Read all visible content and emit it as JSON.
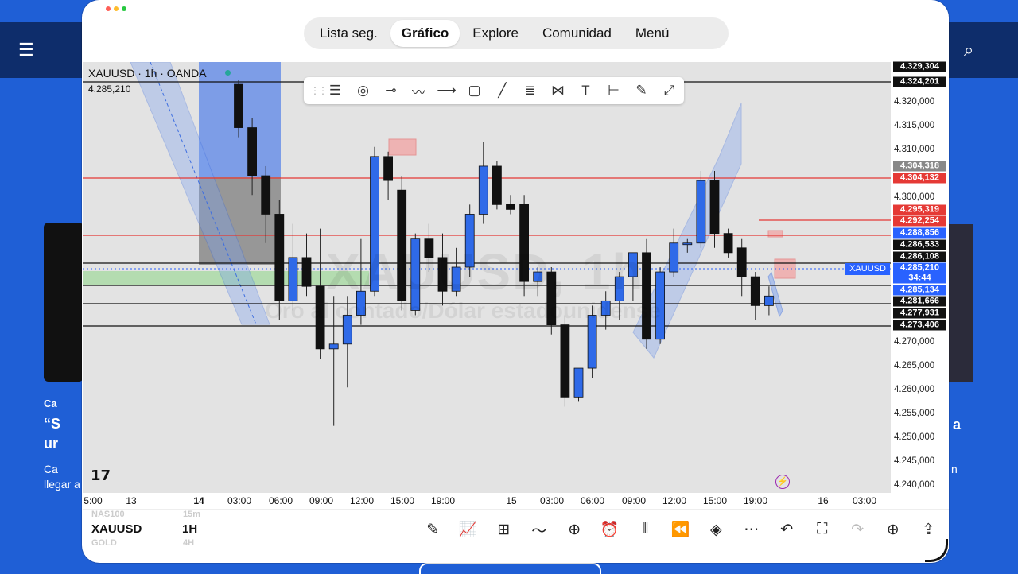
{
  "window": {
    "dot_colors": [
      "#ff5f57",
      "#febc2e",
      "#28c840"
    ]
  },
  "tabs": [
    {
      "label": "Lista seg.",
      "active": false
    },
    {
      "label": "Gráfico",
      "active": true
    },
    {
      "label": "Explore",
      "active": false
    },
    {
      "label": "Comunidad",
      "active": false
    },
    {
      "label": "Menú",
      "active": false
    }
  ],
  "chart": {
    "symbol_line": "XAUUSD · 1h · OANDA",
    "last_price": "4.285,210",
    "watermark_symbol": "XAUUSD, 1h",
    "watermark_name": "Oro al contado/Dólar estadounidense",
    "symbol_tag": "XAUUSD"
  },
  "drawing_tools": [
    "horizontal-lines-icon",
    "circle-target-icon",
    "ray-icon",
    "path-icon",
    "horizontal-ray-icon",
    "rectangle-icon",
    "trend-line-icon",
    "fib-icon",
    "pattern-icon",
    "text-icon",
    "measure-icon",
    "brush-icon",
    "projection-icon"
  ],
  "price_axis": {
    "ticks": [
      "4.320,000",
      "4.315,000",
      "4.310,000",
      "4.300,000",
      "4.270,000",
      "4.265,000",
      "4.260,000",
      "4.255,000",
      "4.250,000",
      "4.245,000",
      "4.240,000"
    ],
    "tags": [
      {
        "label": "4.329,304",
        "color": "#111111"
      },
      {
        "label": "4.324,201",
        "color": "#111111"
      },
      {
        "label": "4.304,318",
        "color": "#888888"
      },
      {
        "label": "4.304,132",
        "color": "#e53935"
      },
      {
        "label": "4.295,319",
        "color": "#e53935"
      },
      {
        "label": "4.292,254",
        "color": "#e53935"
      },
      {
        "label": "4.288,856",
        "color": "#2962ff"
      },
      {
        "label": "4.286,533",
        "color": "#111111"
      },
      {
        "label": "4.286,108",
        "color": "#111111"
      },
      {
        "label": "4.285,210",
        "color": "#2962ff"
      },
      {
        "label": "34:44",
        "color": "#2962ff"
      },
      {
        "label": "4.285,134",
        "color": "#2962ff"
      },
      {
        "label": "4.281,666",
        "color": "#111111"
      },
      {
        "label": "4.277,931",
        "color": "#111111"
      },
      {
        "label": "4.273,406",
        "color": "#111111"
      }
    ]
  },
  "time_axis": [
    {
      "label": "5:00",
      "bold": false
    },
    {
      "label": "13",
      "bold": false
    },
    {
      "label": "14",
      "bold": true
    },
    {
      "label": "03:00",
      "bold": false
    },
    {
      "label": "06:00",
      "bold": false
    },
    {
      "label": "09:00",
      "bold": false
    },
    {
      "label": "12:00",
      "bold": false
    },
    {
      "label": "15:00",
      "bold": false
    },
    {
      "label": "19:00",
      "bold": false
    },
    {
      "label": "15",
      "bold": false
    },
    {
      "label": "03:00",
      "bold": false
    },
    {
      "label": "06:00",
      "bold": false
    },
    {
      "label": "09:00",
      "bold": false
    },
    {
      "label": "12:00",
      "bold": false
    },
    {
      "label": "15:00",
      "bold": false
    },
    {
      "label": "19:00",
      "bold": false
    },
    {
      "label": "16",
      "bold": false
    },
    {
      "label": "03:00",
      "bold": false
    }
  ],
  "bottom_bar": {
    "symbol": "XAUUSD",
    "timeframe": "1H",
    "ghost_symbols": [
      "NAS100",
      "GOLD"
    ],
    "ghost_timeframes": [
      "15m",
      "4H"
    ],
    "icons": [
      "pencil-icon",
      "indicators-icon",
      "layout-grid-icon",
      "compare-icon",
      "add-icon",
      "alert-clock-icon",
      "candles-icon",
      "replay-icon",
      "layers-icon",
      "more-icon",
      "undo-icon",
      "fullscreen-icon",
      "redo-icon",
      "add-symbol-icon",
      "share-icon"
    ]
  },
  "background_page": {
    "left_texts": [
      "Ca",
      "“S",
      "ur",
      "Ca",
      "llegar a"
    ],
    "right_texts": [
      "a",
      "n"
    ]
  },
  "candles": [
    {
      "o": 4329,
      "h": 4330,
      "l": 4318,
      "c": 4320
    },
    {
      "o": 4320,
      "h": 4322,
      "l": 4306,
      "c": 4310
    },
    {
      "o": 4310,
      "h": 4312,
      "l": 4296,
      "c": 4302
    },
    {
      "o": 4302,
      "h": 4305,
      "l": 4280,
      "c": 4284
    },
    {
      "o": 4284,
      "h": 4300,
      "l": 4282,
      "c": 4293
    },
    {
      "o": 4293,
      "h": 4298,
      "l": 4285,
      "c": 4287
    },
    {
      "o": 4287,
      "h": 4299,
      "l": 4272,
      "c": 4274
    },
    {
      "o": 4274,
      "h": 4285,
      "l": 4258,
      "c": 4275
    },
    {
      "o": 4275,
      "h": 4285,
      "l": 4266,
      "c": 4281
    },
    {
      "o": 4281,
      "h": 4297,
      "l": 4279,
      "c": 4286
    },
    {
      "o": 4286,
      "h": 4316,
      "l": 4285,
      "c": 4314
    },
    {
      "o": 4314,
      "h": 4315,
      "l": 4305,
      "c": 4309
    },
    {
      "o": 4307,
      "h": 4310,
      "l": 4282,
      "c": 4284
    },
    {
      "o": 4282,
      "h": 4298,
      "l": 4281,
      "c": 4297
    },
    {
      "o": 4297,
      "h": 4300,
      "l": 4290,
      "c": 4293
    },
    {
      "o": 4293,
      "h": 4298,
      "l": 4283,
      "c": 4286
    },
    {
      "o": 4286,
      "h": 4295,
      "l": 4285,
      "c": 4291
    },
    {
      "o": 4291,
      "h": 4304,
      "l": 4289,
      "c": 4302
    },
    {
      "o": 4302,
      "h": 4317,
      "l": 4300,
      "c": 4312
    },
    {
      "o": 4312,
      "h": 4313,
      "l": 4303,
      "c": 4304
    },
    {
      "o": 4304,
      "h": 4306,
      "l": 4302,
      "c": 4303
    },
    {
      "o": 4304,
      "h": 4306,
      "l": 4285,
      "c": 4288
    },
    {
      "o": 4288,
      "h": 4291,
      "l": 4285,
      "c": 4290
    },
    {
      "o": 4290,
      "h": 4291,
      "l": 4277,
      "c": 4279
    },
    {
      "o": 4279,
      "h": 4281,
      "l": 4262,
      "c": 4264
    },
    {
      "o": 4264,
      "h": 4270,
      "l": 4263,
      "c": 4270
    },
    {
      "o": 4270,
      "h": 4283,
      "l": 4268,
      "c": 4281
    },
    {
      "o": 4281,
      "h": 4286,
      "l": 4278,
      "c": 4284
    },
    {
      "o": 4284,
      "h": 4290,
      "l": 4280,
      "c": 4289
    },
    {
      "o": 4289,
      "h": 4294,
      "l": 4284,
      "c": 4294
    },
    {
      "o": 4294,
      "h": 4297,
      "l": 4274,
      "c": 4276
    },
    {
      "o": 4276,
      "h": 4291,
      "l": 4275,
      "c": 4290
    },
    {
      "o": 4290,
      "h": 4299,
      "l": 4289,
      "c": 4296
    },
    {
      "o": 4296,
      "h": 4297,
      "l": 4294,
      "c": 4296
    },
    {
      "o": 4296,
      "h": 4311,
      "l": 4295,
      "c": 4309
    },
    {
      "o": 4309,
      "h": 4311,
      "l": 4295,
      "c": 4298
    },
    {
      "o": 4298,
      "h": 4299,
      "l": 4293,
      "c": 4294
    },
    {
      "o": 4295,
      "h": 4297,
      "l": 4285,
      "c": 4289
    },
    {
      "o": 4289,
      "h": 4290,
      "l": 4280,
      "c": 4283
    },
    {
      "o": 4283,
      "h": 4287,
      "l": 4281,
      "c": 4285
    }
  ]
}
